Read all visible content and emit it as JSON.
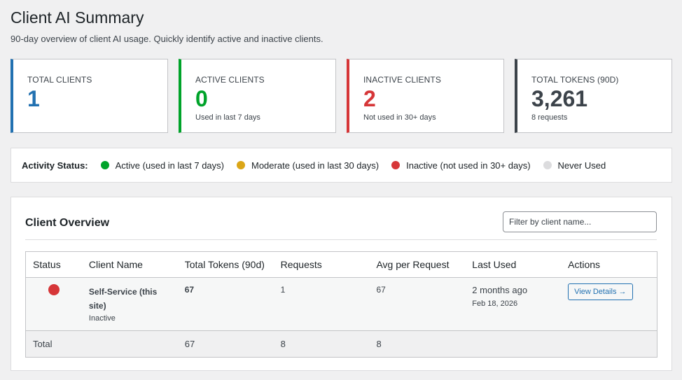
{
  "header": {
    "title": "Client AI Summary",
    "subtitle": "90-day overview of client AI usage. Quickly identify active and inactive clients."
  },
  "cards": [
    {
      "label": "TOTAL CLIENTS",
      "value": "1",
      "note": "",
      "color": "#2271b1"
    },
    {
      "label": "ACTIVE CLIENTS",
      "value": "0",
      "note": "Used in last 7 days",
      "color": "#00a32a"
    },
    {
      "label": "INACTIVE CLIENTS",
      "value": "2",
      "note": "Not used in 30+ days",
      "color": "#d63638"
    },
    {
      "label": "TOTAL TOKENS (90D)",
      "value": "3,261",
      "note": "8 requests",
      "color": "#3c434a"
    }
  ],
  "legend": {
    "title": "Activity Status:",
    "items": [
      {
        "label": "Active (used in last 7 days)",
        "color": "#00a32a"
      },
      {
        "label": "Moderate (used in last 30 days)",
        "color": "#dba617"
      },
      {
        "label": "Inactive (not used in 30+ days)",
        "color": "#d63638"
      },
      {
        "label": "Never Used",
        "color": "#dcdcde"
      }
    ]
  },
  "overview": {
    "title": "Client Overview",
    "filter_placeholder": "Filter by client name...",
    "columns": [
      "Status",
      "Client Name",
      "Total Tokens (90d)",
      "Requests",
      "Avg per Request",
      "Last Used",
      "Actions"
    ],
    "rows": [
      {
        "status_color": "#d63638",
        "client_name": "Self-Service (this site)",
        "client_status": "Inactive",
        "total_tokens": "67",
        "requests": "1",
        "avg": "67",
        "last_used": "2 months ago",
        "last_used_date": "Feb 18, 2026",
        "action": "View Details →"
      }
    ],
    "footer": {
      "label": "Total",
      "total_tokens": "67",
      "requests": "8",
      "avg": "8"
    }
  }
}
